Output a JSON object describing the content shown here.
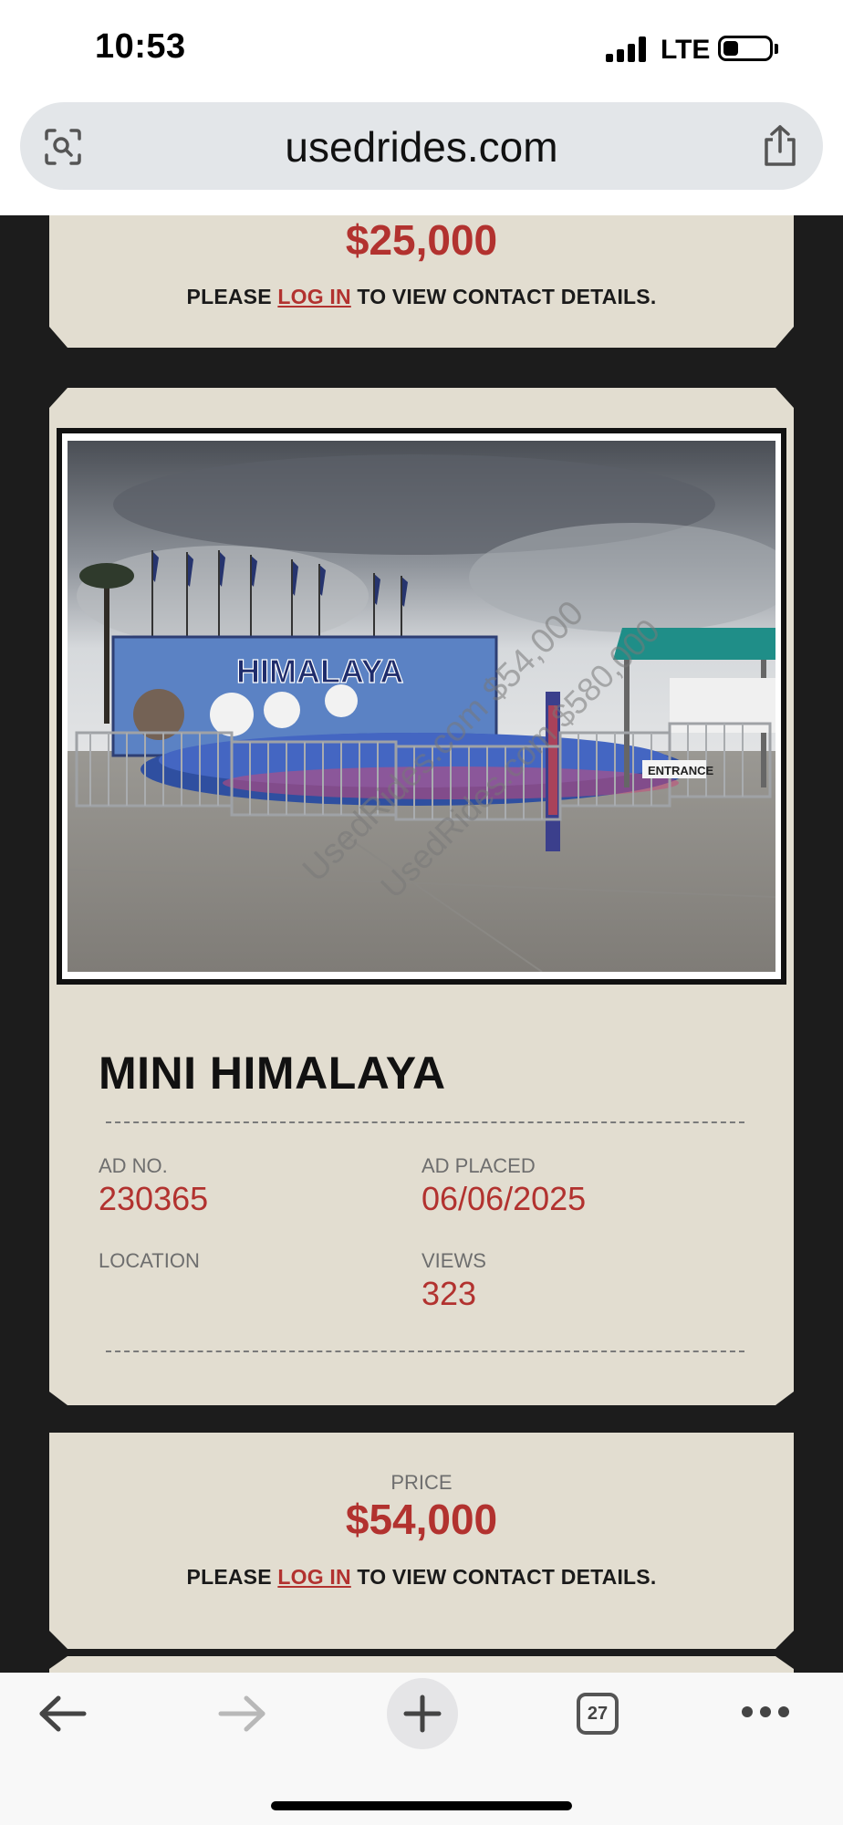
{
  "status_bar": {
    "time": "10:53",
    "network": "LTE"
  },
  "browser": {
    "url": "usedrides.com",
    "tab_count": "27"
  },
  "listings": [
    {
      "price": "$25,000",
      "contact": {
        "prefix": "PLEASE ",
        "link": "LOG IN",
        "suffix": " TO VIEW CONTACT DETAILS."
      }
    },
    {
      "title": "MINI HIMALAYA",
      "watermark": "UsedRides.com",
      "watermark_price": "$54,000",
      "watermark_2": "UsedRides.com",
      "watermark_price_2": "$580,000",
      "ad_no_label": "AD NO.",
      "ad_no": "230365",
      "ad_placed_label": "AD PLACED",
      "ad_placed": "06/06/2025",
      "location_label": "LOCATION",
      "location": "",
      "views_label": "VIEWS",
      "views": "323",
      "price_label": "PRICE",
      "price": "$54,000",
      "contact": {
        "prefix": "PLEASE ",
        "link": "LOG IN",
        "suffix": " TO VIEW CONTACT DETAILS."
      },
      "sign_text": "HIMALAYA",
      "entrance_sign": "ENTRANCE"
    }
  ],
  "colors": {
    "accent": "#b2322f",
    "card": "#e2ddd0",
    "page_bg": "#1c1c1c"
  }
}
